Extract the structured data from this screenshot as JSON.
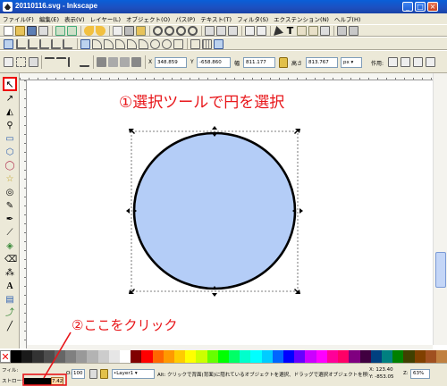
{
  "window": {
    "title": "20110116.svg - Inkscape",
    "buttons": {
      "minimize": "_",
      "maximize": "□",
      "close": "×"
    }
  },
  "menu": {
    "items": [
      "ファイル(F)",
      "編集(E)",
      "表示(V)",
      "レイヤー(L)",
      "オブジェクト(O)",
      "パス(P)",
      "テキスト(T)",
      "フィルタ(S)",
      "エクステンション(N)",
      "ヘルプ(H)"
    ]
  },
  "toolcontrols": {
    "x_label": "X",
    "x_value": "348.859",
    "y_label": "Y",
    "y_value": "-658.860",
    "w_label": "幅",
    "w_value": "811.177",
    "h_label": "高さ",
    "h_value": "813.767",
    "unit": "px",
    "affect_label": "作用:"
  },
  "tools": [
    {
      "name": "selector-tool",
      "glyph": "↖"
    },
    {
      "name": "node-tool",
      "glyph": "↗"
    },
    {
      "name": "tweak-tool",
      "glyph": "◭"
    },
    {
      "name": "zoom-tool",
      "glyph": "⚲"
    },
    {
      "name": "rectangle-tool",
      "glyph": "▭"
    },
    {
      "name": "3d-box-tool",
      "glyph": "⬡"
    },
    {
      "name": "ellipse-tool",
      "glyph": "◯"
    },
    {
      "name": "star-tool",
      "glyph": "☆"
    },
    {
      "name": "spiral-tool",
      "glyph": "◎"
    },
    {
      "name": "pencil-tool",
      "glyph": "✎"
    },
    {
      "name": "pen-tool",
      "glyph": "✒"
    },
    {
      "name": "calligraphy-tool",
      "glyph": "⟋"
    },
    {
      "name": "paint-bucket-tool",
      "glyph": "◈"
    },
    {
      "name": "eraser-tool",
      "glyph": "⌫"
    },
    {
      "name": "spray-tool",
      "glyph": "⁂"
    },
    {
      "name": "text-tool",
      "glyph": "A"
    },
    {
      "name": "gradient-tool",
      "glyph": "▤"
    },
    {
      "name": "connector-tool",
      "glyph": "⤴"
    },
    {
      "name": "dropper-tool",
      "glyph": "╱"
    }
  ],
  "annotations": {
    "step1": "①選択ツールで円を選択",
    "step2": "②ここをクリック"
  },
  "canvas": {
    "circle_fill": "#b4cdf7",
    "circle_stroke": "#000000"
  },
  "status": {
    "fill_label": "フィル:",
    "stroke_label": "ストローク:",
    "stroke_width": "7.42",
    "opacity_label": "O:",
    "opacity_value": "100",
    "layer": "•Layer1",
    "message": "Alt: クリックで背面(背面)に隠れているオブジェクトを選択、ドラッグで選択オブジェクトを移動または範囲",
    "x_coord": "X: 123.40",
    "y_coord": "Y: -853.05",
    "zoom_label": "Z:",
    "zoom": "63%"
  },
  "colors": {
    "annotation_red": "#e8161a",
    "titlebar_blue": "#1d4fbf",
    "chrome": "#ece9d8"
  },
  "palette": [
    "#000000",
    "#1a1a1a",
    "#333333",
    "#4d4d4d",
    "#666666",
    "#808080",
    "#999999",
    "#b3b3b3",
    "#cccccc",
    "#e6e6e6",
    "#ffffff",
    "#800000",
    "#ff0000",
    "#ff6600",
    "#ff9900",
    "#ffcc00",
    "#ffff00",
    "#ccff00",
    "#66ff00",
    "#00ff00",
    "#00ff66",
    "#00ffcc",
    "#00ffff",
    "#00ccff",
    "#0066ff",
    "#0000ff",
    "#6600ff",
    "#cc00ff",
    "#ff00ff",
    "#ff0099",
    "#ff0066",
    "#800080",
    "#400040",
    "#004080",
    "#008080",
    "#008000",
    "#404000",
    "#804000",
    "#a05020",
    "#c08040"
  ]
}
